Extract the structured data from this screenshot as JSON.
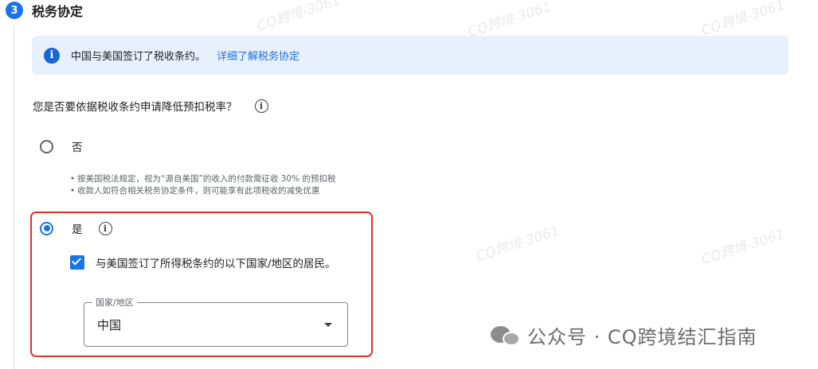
{
  "step": {
    "number": "3",
    "title": "税务协定"
  },
  "info": {
    "text": "中国与美国签订了税收条约。",
    "link": "详细了解税务协定"
  },
  "question": {
    "text": "您是否要依据税收条约申请降低预扣税率？"
  },
  "options": {
    "no": {
      "label": "否",
      "selected": false
    },
    "yes": {
      "label": "是",
      "selected": true
    }
  },
  "no_bullets": [
    "按美国税法规定，视为“源自美国”的收入的付款需征收 30% 的预扣税",
    "收款人如符合相关税务协定条件，则可能享有此项税收的减免优惠"
  ],
  "treaty_checkbox": {
    "label": "与美国签订了所得税条约的以下国家/地区的居民。",
    "checked": true
  },
  "country_select": {
    "legend": "国家/地区",
    "value": "中国"
  },
  "watermark": {
    "text": "CQ跨境-3061"
  },
  "brand": {
    "text": "公众号 · CQ跨境结汇指南"
  },
  "colors": {
    "accent": "#1a73e8",
    "info_bg": "#e8f0fe",
    "highlight": "#e0302a"
  }
}
